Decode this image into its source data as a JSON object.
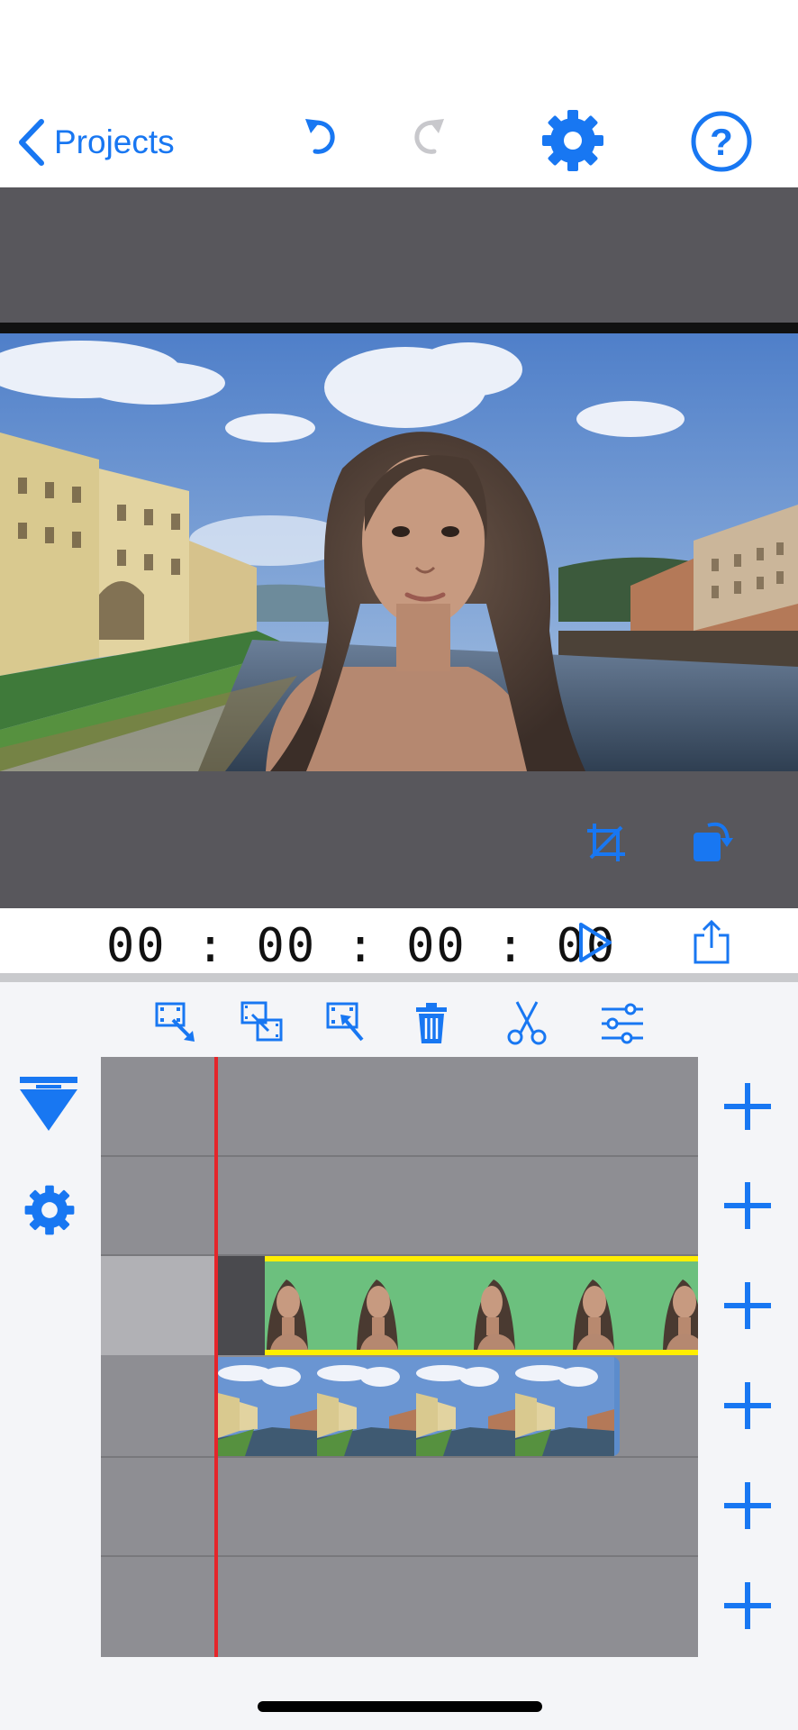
{
  "nav": {
    "back_label": "Projects",
    "accent_color": "#1877f2",
    "icons": [
      "chevron-left-icon",
      "undo-icon",
      "redo-icon",
      "gear-icon",
      "help-icon"
    ]
  },
  "preview": {
    "icons": [
      "crop-icon",
      "rotate-icon"
    ]
  },
  "playback": {
    "timecode": "00 : 00 : 00 : 00",
    "icons": [
      "play-icon",
      "share-icon"
    ]
  },
  "tools": [
    "clip-trim-icon",
    "clip-duplicate-icon",
    "clip-select-icon",
    "trash-icon",
    "scissors-icon",
    "sliders-icon"
  ],
  "timeline": {
    "tracks": 6,
    "side_icons": [
      "collapse-icon",
      "gear-icon"
    ],
    "add_buttons": 6,
    "playhead_color": "#e5252a",
    "selected_clip_border": "#ffee00"
  }
}
